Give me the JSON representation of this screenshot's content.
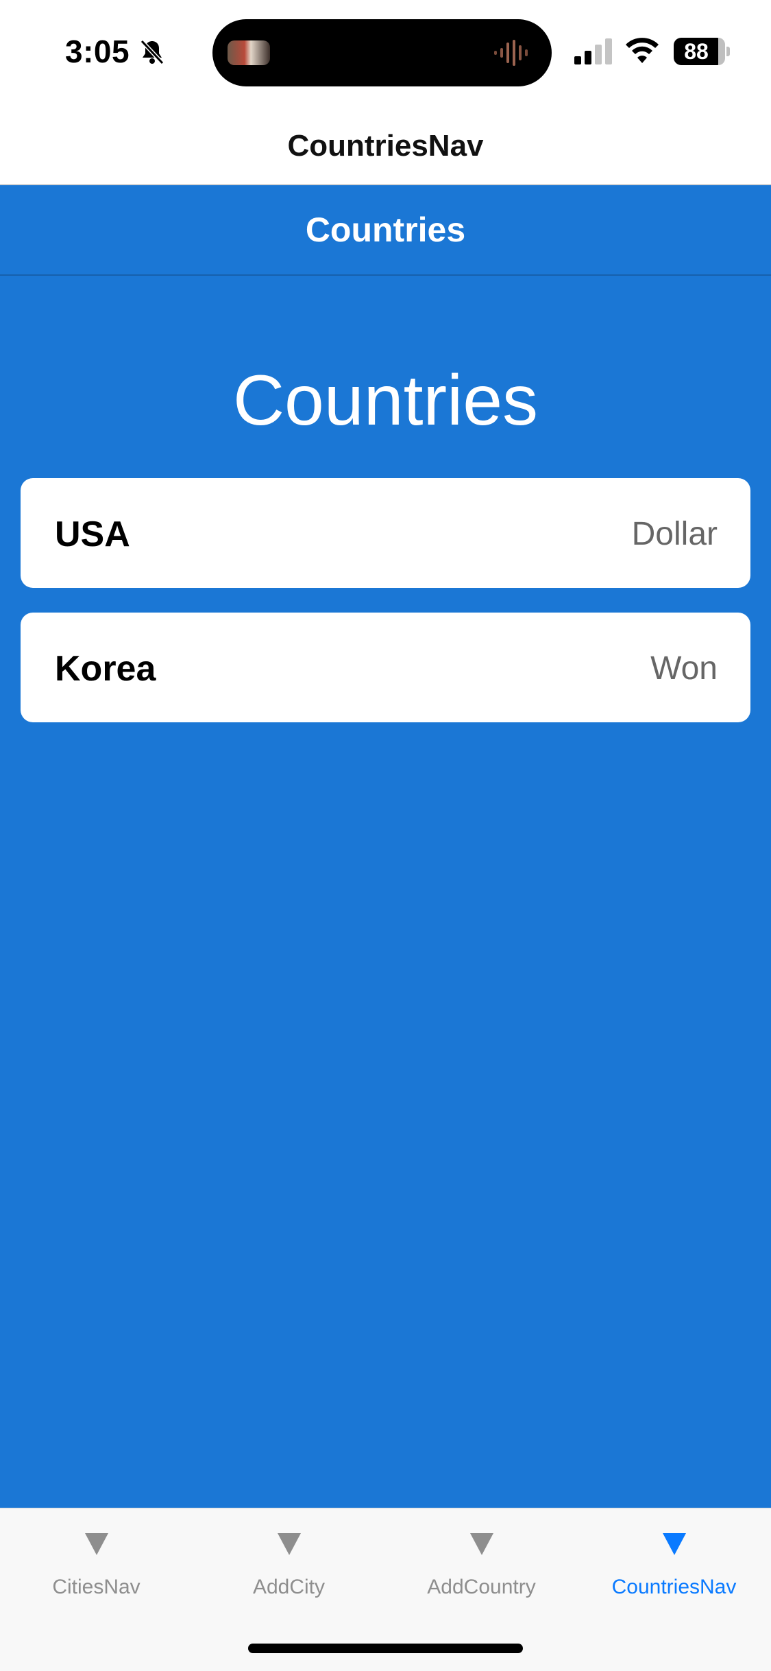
{
  "status_bar": {
    "time": "3:05",
    "battery": "88"
  },
  "outer_nav": {
    "title": "CountriesNav"
  },
  "screen": {
    "header_title": "Countries",
    "large_title": "Countries",
    "background_color": "#1b77d5",
    "countries": [
      {
        "name": "USA",
        "currency": "Dollar"
      },
      {
        "name": "Korea",
        "currency": "Won"
      }
    ]
  },
  "tab_bar": {
    "active_color": "#0a7aff",
    "tabs": [
      {
        "label": "CitiesNav",
        "icon": "triangle-down-icon",
        "active": false
      },
      {
        "label": "AddCity",
        "icon": "triangle-down-icon",
        "active": false
      },
      {
        "label": "AddCountry",
        "icon": "triangle-down-icon",
        "active": false
      },
      {
        "label": "CountriesNav",
        "icon": "triangle-down-icon",
        "active": true
      }
    ]
  }
}
